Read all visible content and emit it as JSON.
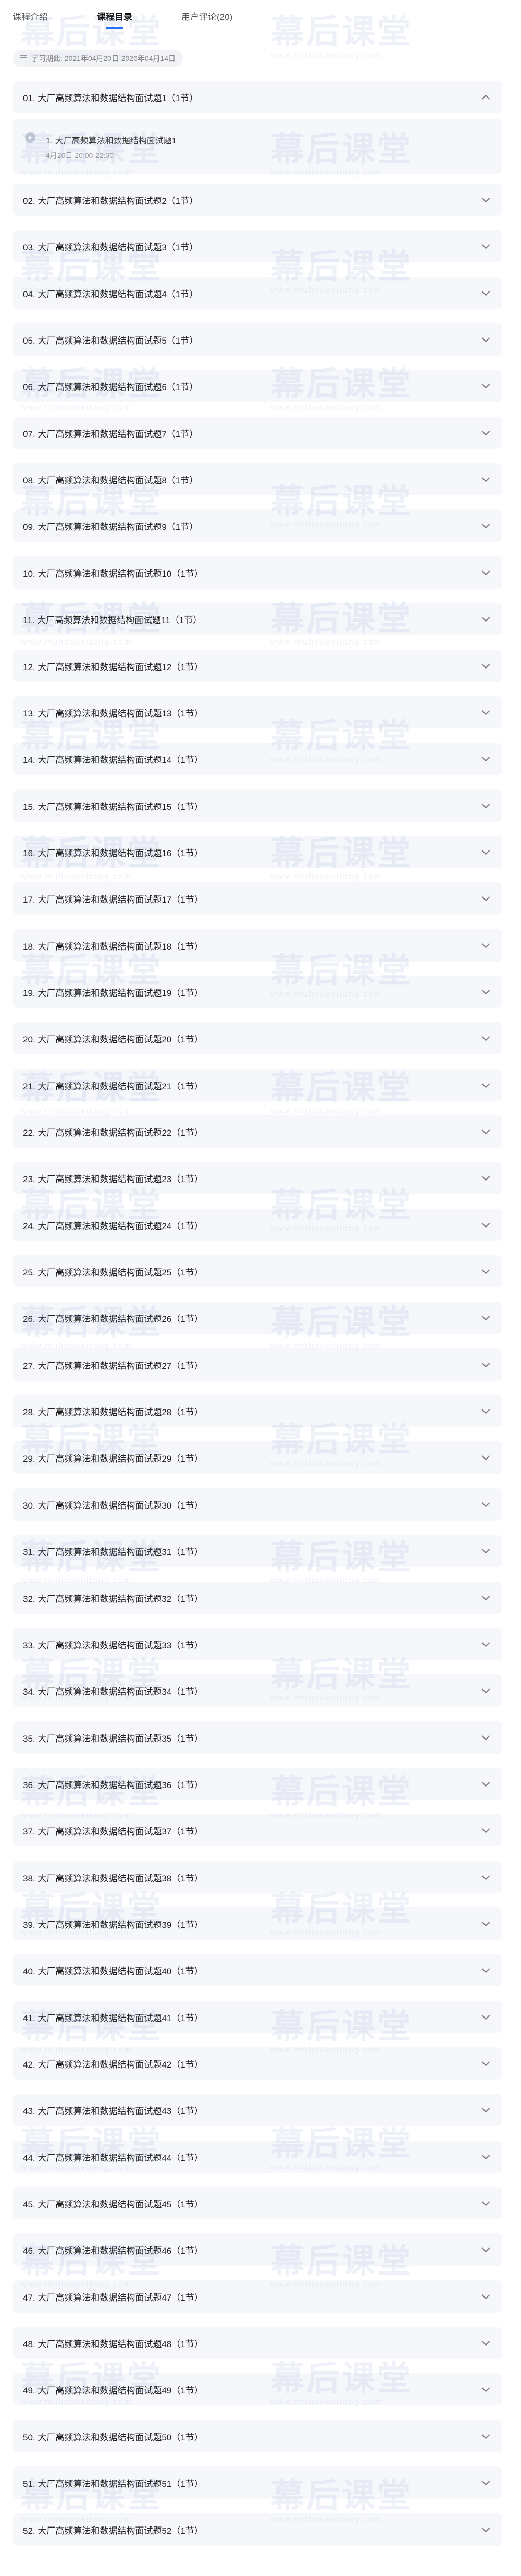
{
  "tabs": [
    {
      "label": "课程介绍",
      "active": false
    },
    {
      "label": "课程目录",
      "active": true
    },
    {
      "label": "用户评论(20)",
      "active": false
    }
  ],
  "period": "学习期此: 2021年04月20日-2026年04月14日",
  "chapters": [
    {
      "title": "01. 大厂高频算法和数据结构面试题1（1节）",
      "open": true,
      "sections": [
        {
          "title": "1. 大厂高频算法和数据结构面试题1",
          "time": "4月20日 20:00-22:00"
        }
      ]
    },
    {
      "title": "02. 大厂高频算法和数据结构面试题2（1节）"
    },
    {
      "title": "03. 大厂高频算法和数据结构面试题3（1节）"
    },
    {
      "title": "04. 大厂高频算法和数据结构面试题4（1节）"
    },
    {
      "title": "05. 大厂高频算法和数据结构面试题5（1节）"
    },
    {
      "title": "06. 大厂高频算法和数据结构面试题6（1节）"
    },
    {
      "title": "07. 大厂高频算法和数据结构面试题7（1节）"
    },
    {
      "title": "08. 大厂高频算法和数据结构面试题8（1节）"
    },
    {
      "title": "09. 大厂高频算法和数据结构面试题9（1节）"
    },
    {
      "title": "10. 大厂高频算法和数据结构面试题10（1节）"
    },
    {
      "title": "11. 大厂高频算法和数据结构面试题11（1节）"
    },
    {
      "title": "12. 大厂高频算法和数据结构面试题12（1节）"
    },
    {
      "title": "13. 大厂高频算法和数据结构面试题13（1节）"
    },
    {
      "title": "14. 大厂高频算法和数据结构面试题14（1节）"
    },
    {
      "title": "15. 大厂高频算法和数据结构面试题15（1节）"
    },
    {
      "title": "16. 大厂高频算法和数据结构面试题16（1节）"
    },
    {
      "title": "17. 大厂高频算法和数据结构面试题17（1节）"
    },
    {
      "title": "18. 大厂高频算法和数据结构面试题18（1节）"
    },
    {
      "title": "19. 大厂高频算法和数据结构面试题19（1节）"
    },
    {
      "title": "20. 大厂高频算法和数据结构面试题20（1节）"
    },
    {
      "title": "21. 大厂高频算法和数据结构面试题21（1节）"
    },
    {
      "title": "22. 大厂高频算法和数据结构面试题22（1节）"
    },
    {
      "title": "23. 大厂高频算法和数据结构面试题23（1节）"
    },
    {
      "title": "24. 大厂高频算法和数据结构面试题24（1节）"
    },
    {
      "title": "25. 大厂高频算法和数据结构面试题25（1节）"
    },
    {
      "title": "26. 大厂高频算法和数据结构面试题26（1节）"
    },
    {
      "title": "27. 大厂高频算法和数据结构面试题27（1节）"
    },
    {
      "title": "28. 大厂高频算法和数据结构面试题28（1节）"
    },
    {
      "title": "29. 大厂高频算法和数据结构面试题29（1节）"
    },
    {
      "title": "30. 大厂高频算法和数据结构面试题30（1节）"
    },
    {
      "title": "31. 大厂高频算法和数据结构面试题31（1节）"
    },
    {
      "title": "32. 大厂高频算法和数据结构面试题32（1节）"
    },
    {
      "title": "33. 大厂高频算法和数据结构面试题33（1节）"
    },
    {
      "title": "34. 大厂高频算法和数据结构面试题34（1节）"
    },
    {
      "title": "35. 大厂高频算法和数据结构面试题35（1节）"
    },
    {
      "title": "36. 大厂高频算法和数据结构面试题36（1节）"
    },
    {
      "title": "37. 大厂高频算法和数据结构面试题37（1节）"
    },
    {
      "title": "38. 大厂高频算法和数据结构面试题38（1节）"
    },
    {
      "title": "39. 大厂高频算法和数据结构面试题39（1节）"
    },
    {
      "title": "40. 大厂高频算法和数据结构面试题40（1节）"
    },
    {
      "title": "41. 大厂高频算法和数据结构面试题41（1节）"
    },
    {
      "title": "42. 大厂高频算法和数据结构面试题42（1节）"
    },
    {
      "title": "43. 大厂高频算法和数据结构面试题43（1节）"
    },
    {
      "title": "44. 大厂高频算法和数据结构面试题44（1节）"
    },
    {
      "title": "45. 大厂高频算法和数据结构面试题45（1节）"
    },
    {
      "title": "46. 大厂高频算法和数据结构面试题46（1节）"
    },
    {
      "title": "47. 大厂高频算法和数据结构面试题47（1节）"
    },
    {
      "title": "48. 大厂高频算法和数据结构面试题48（1节）"
    },
    {
      "title": "49. 大厂高频算法和数据结构面试题49（1节）"
    },
    {
      "title": "50. 大厂高频算法和数据结构面试题50（1节）"
    },
    {
      "title": "51. 大厂高频算法和数据结构面试题51（1节）"
    },
    {
      "title": "52. 大厂高频算法和数据结构面试题52（1节）"
    }
  ],
  "watermark": {
    "text": "幕后课堂",
    "url": "www.muhoukeitang.com"
  },
  "icons": {
    "calendar": "calendar-icon",
    "chevron_up": "chevron-up-icon",
    "chevron_down": "chevron-down-icon",
    "play": "play-icon"
  },
  "colors": {
    "accent": "#1a6cff",
    "row_bg": "#f5f7fb",
    "pill_bg": "#f1f3f7"
  }
}
